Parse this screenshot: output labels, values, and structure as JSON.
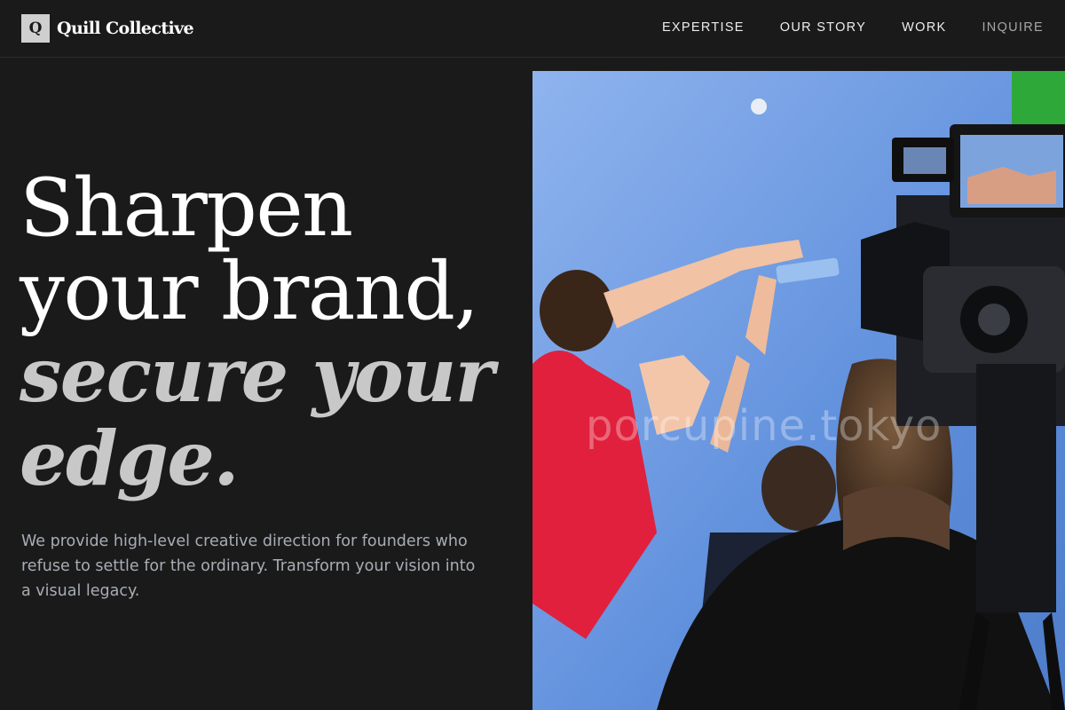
{
  "brand": {
    "mark": "Q",
    "name": "Quill Collective"
  },
  "nav": [
    {
      "label": "EXPERTISE"
    },
    {
      "label": "OUR STORY"
    },
    {
      "label": "WORK"
    },
    {
      "label": "INQUIRE"
    }
  ],
  "hero": {
    "headline": [
      "Sharpen",
      "your brand,",
      "secure your",
      "edge."
    ],
    "lede": "We provide high-level creative direction for founders who refuse to settle for the ordinary. Transform your vision into a visual legacy.",
    "image": "film-set-photo",
    "watermark": "porcupine.tokyo"
  },
  "colors": {
    "background": "#1a1a1a",
    "muted_text": "#a8adb5",
    "italic_text": "#c8c8c8"
  }
}
